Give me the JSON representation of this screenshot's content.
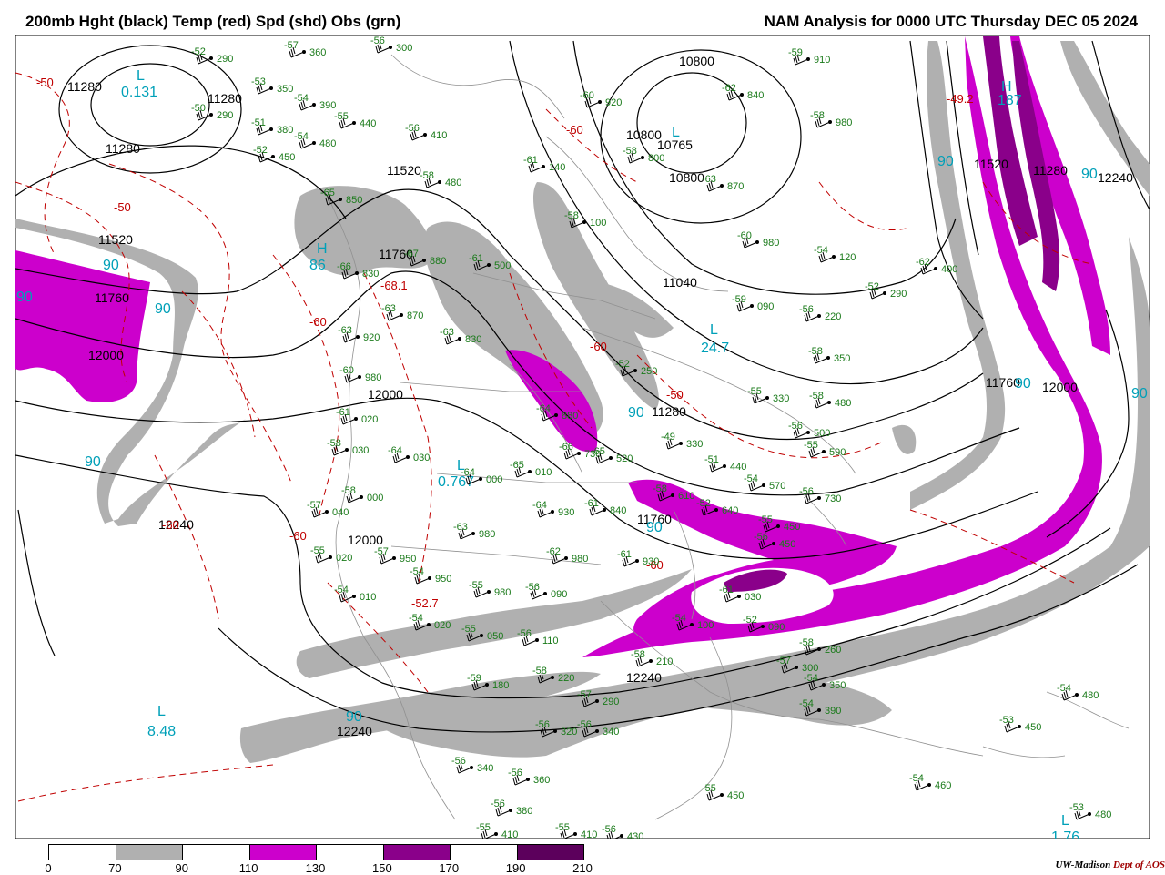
{
  "header": {
    "title_left": "200mb Hght (black) Temp (red) Spd (shd) Obs (grn)",
    "title_right": "NAM Analysis for 0000 UTC Thursday  DEC 05 2024"
  },
  "colors": {
    "height_contours": "#000000",
    "temperature_contours": "#c00000",
    "observations": "#1a7a1a",
    "centers": "#00a0b8",
    "speed_70_90": "#b0b0b0",
    "speed_110_130": "#cc00cc",
    "speed_150_170": "#8a008a",
    "speed_190_210": "#5c005c"
  },
  "map": {
    "height_labels": [
      "11280",
      "11280",
      "11280",
      "11520",
      "11520",
      "11760",
      "11760",
      "12000",
      "12000",
      "12000",
      "12240",
      "12240",
      "12240",
      "12240",
      "10800",
      "10800",
      "10800",
      "11040",
      "11280",
      "11520",
      "11760",
      "12000",
      "11280",
      "11760"
    ],
    "speed_labels": [
      "90",
      "90",
      "90",
      "90",
      "90",
      "90",
      "90",
      "90",
      "90",
      "90",
      "90"
    ],
    "temp_labels": [
      "-50",
      "-50",
      "-60",
      "-60",
      "-60",
      "-60",
      "-50",
      "-60",
      "-52.7",
      "-60",
      "-49.2",
      "-68.1"
    ],
    "centers": [
      {
        "letter": "L",
        "value": "0.131"
      },
      {
        "letter": "H",
        "value": "86"
      },
      {
        "letter": "L",
        "value": "10765"
      },
      {
        "letter": "L",
        "value": "24.7"
      },
      {
        "letter": "L",
        "value": "0.767"
      },
      {
        "letter": "L",
        "value": "8.48"
      },
      {
        "letter": "H",
        "value": "187"
      },
      {
        "letter": "L",
        "value": "1.76"
      }
    ],
    "observations": [
      [
        "-52",
        "290"
      ],
      [
        "-53",
        "350"
      ],
      [
        "-54",
        "390"
      ],
      [
        "-50",
        "290"
      ],
      [
        "-51",
        "380"
      ],
      [
        "-55",
        "440"
      ],
      [
        "-54",
        "480"
      ],
      [
        "-52",
        "450"
      ],
      [
        "-57",
        "360"
      ],
      [
        "-56",
        "300"
      ],
      [
        "-56",
        "410"
      ],
      [
        "-58",
        "480"
      ],
      [
        "-59",
        "910"
      ],
      [
        "-62",
        "840"
      ],
      [
        "-58",
        "980"
      ],
      [
        "-60",
        "920"
      ],
      [
        "-58",
        "800"
      ],
      [
        "-61",
        "140"
      ],
      [
        "-63",
        "870"
      ],
      [
        "-58",
        "100"
      ],
      [
        "-60",
        "980"
      ],
      [
        "-54",
        "120"
      ],
      [
        "-62",
        "400"
      ],
      [
        "-52",
        "290"
      ],
      [
        "-56",
        "220"
      ],
      [
        "-59",
        "090"
      ],
      [
        "-61",
        "500"
      ],
      [
        "-67",
        "880"
      ],
      [
        "-65",
        "850"
      ],
      [
        "-66",
        "830"
      ],
      [
        "-63",
        "870"
      ],
      [
        "-63",
        "920"
      ],
      [
        "-63",
        "830"
      ],
      [
        "-60",
        "980"
      ],
      [
        "-61",
        "020"
      ],
      [
        "-58",
        "030"
      ],
      [
        "-64",
        "030"
      ],
      [
        "-64",
        "000"
      ],
      [
        "-65",
        "010"
      ],
      [
        "-64",
        "930"
      ],
      [
        "-63",
        "980"
      ],
      [
        "-62",
        "980"
      ],
      [
        "-57",
        "040"
      ],
      [
        "-58",
        "000"
      ],
      [
        "-55",
        "020"
      ],
      [
        "-57",
        "950"
      ],
      [
        "-54",
        "950"
      ],
      [
        "-54",
        "010"
      ],
      [
        "-55",
        "980"
      ],
      [
        "-56",
        "090"
      ],
      [
        "-54",
        "020"
      ],
      [
        "-55",
        "050"
      ],
      [
        "-56",
        "110"
      ],
      [
        "-59",
        "180"
      ],
      [
        "-58",
        "220"
      ],
      [
        "-57",
        "290"
      ],
      [
        "-56",
        "320"
      ],
      [
        "-56",
        "340"
      ],
      [
        "-56",
        "340"
      ],
      [
        "-56",
        "360"
      ],
      [
        "-56",
        "380"
      ],
      [
        "-55",
        "410"
      ],
      [
        "-55",
        "410"
      ],
      [
        "-56",
        "430"
      ],
      [
        "-55",
        "450"
      ],
      [
        "-54",
        "460"
      ],
      [
        "-53",
        "480"
      ],
      [
        "-53",
        "450"
      ],
      [
        "-54",
        "480"
      ],
      [
        "-54",
        "390"
      ],
      [
        "-54",
        "350"
      ],
      [
        "-58",
        "260"
      ],
      [
        "-57",
        "300"
      ],
      [
        "-58",
        "210"
      ],
      [
        "-52",
        "250"
      ],
      [
        "-58",
        "350"
      ],
      [
        "-58",
        "480"
      ],
      [
        "-55",
        "330"
      ],
      [
        "-49",
        "330"
      ],
      [
        "-51",
        "440"
      ],
      [
        "-56",
        "500"
      ],
      [
        "-55",
        "590"
      ],
      [
        "-56",
        "730"
      ],
      [
        "-52",
        "640"
      ],
      [
        "-54",
        "570"
      ],
      [
        "-55",
        "450"
      ],
      [
        "-61",
        "930"
      ],
      [
        "-61",
        "840"
      ],
      [
        "-64",
        "880"
      ],
      [
        "-66",
        "730"
      ],
      [
        "-65",
        "520"
      ],
      [
        "-58",
        "610"
      ],
      [
        "-61",
        "030"
      ],
      [
        "-52",
        "090"
      ],
      [
        "-54",
        "100"
      ],
      [
        "-56",
        "450"
      ]
    ]
  },
  "legend": {
    "ticks": [
      "0",
      "70",
      "90",
      "110",
      "130",
      "150",
      "170",
      "190",
      "210"
    ],
    "swatch_colors": [
      "#ffffff",
      "#b0b0b0",
      "#ffffff",
      "#cc00cc",
      "#ffffff",
      "#8a008a",
      "#ffffff",
      "#5c005c"
    ]
  },
  "credit": {
    "left": "UW-Madison",
    "right": "Dept of AOS"
  }
}
